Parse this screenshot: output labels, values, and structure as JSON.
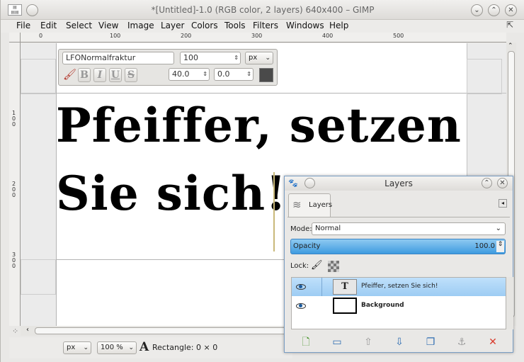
{
  "window": {
    "title": "*[Untitled]-1.0 (RGB color, 2 layers) 640x400 – GIMP",
    "min_glyph": "⌄",
    "max_glyph": "⌃",
    "close_glyph": "✕"
  },
  "menu": [
    "File",
    "Edit",
    "Select",
    "View",
    "Image",
    "Layer",
    "Colors",
    "Tools",
    "Filters",
    "Windows",
    "Help"
  ],
  "ruler": {
    "top_ticks": [
      "0",
      "100",
      "200",
      "300",
      "400",
      "500"
    ],
    "left_ticks": [
      "1 0 0",
      "2 0 0",
      "3 0 0"
    ]
  },
  "text_toolbox": {
    "font_name": "LFONormalfraktur",
    "font_size": "100",
    "unit": "px",
    "indent": "40.0",
    "line_spacing": "0.0",
    "text_color": "#4a4a4a",
    "style_buttons": [
      "B",
      "I",
      "U",
      "S"
    ]
  },
  "canvas": {
    "text": "Pfeiffer, setzen\nSie sich!"
  },
  "status": {
    "unit": "px",
    "zoom": "100 %",
    "tool_message": "Rectangle: 0 × 0"
  },
  "layers_dialog": {
    "title": "Layers",
    "tab_label": "Layers",
    "mode_label": "Mode:",
    "mode_value": "Normal",
    "opacity_label": "Opacity",
    "opacity_value": "100.0",
    "lock_label": "Lock:",
    "layers": [
      {
        "name": "Pfeiffer, setzen Sie sich!",
        "selected": true,
        "thumb": "T"
      },
      {
        "name": "Background",
        "selected": false,
        "thumb": ""
      }
    ]
  },
  "colors": {
    "accent_blue": "#3e9be0",
    "selected_row": "#bfe0fb",
    "delete_red": "#d93a2b"
  }
}
